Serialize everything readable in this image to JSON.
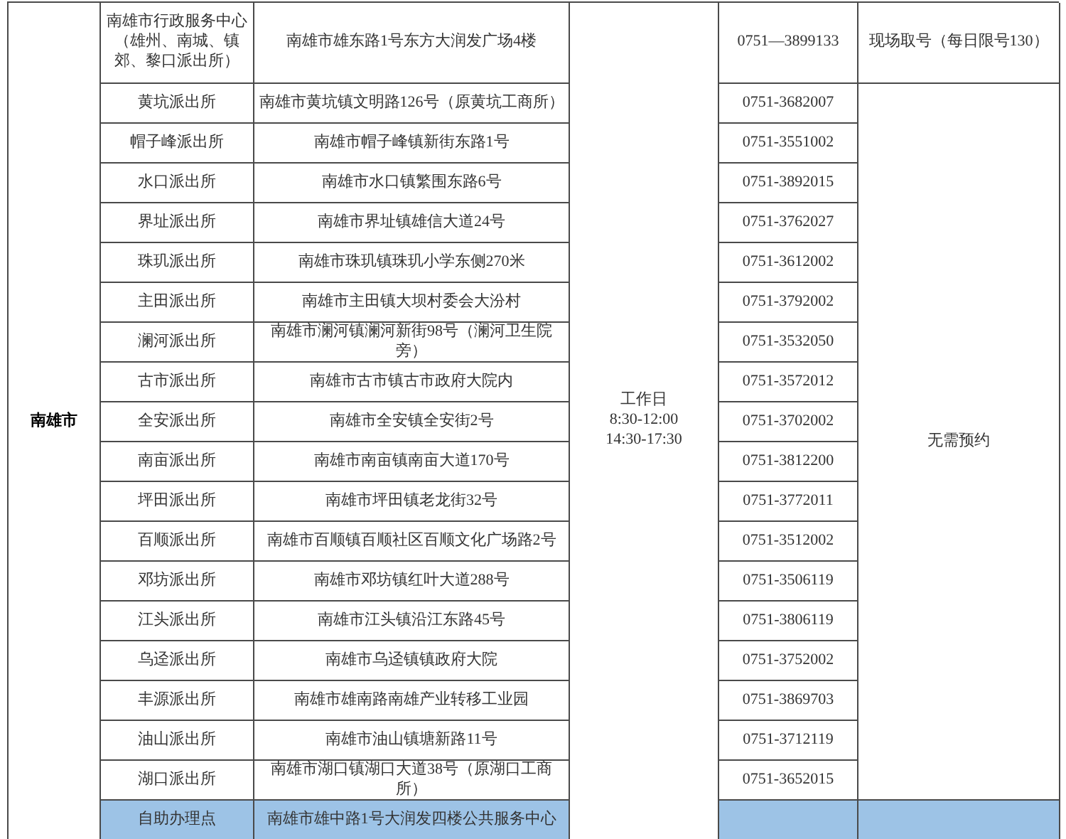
{
  "city": "南雄市",
  "hours": [
    "工作日",
    "8:30-12:00",
    "14:30-17:30"
  ],
  "shared_appointment": "无需预约",
  "rows": [
    {
      "kind": "station",
      "name": "南雄市行政服务中心（雄州、南城、镇郊、黎口派出所）",
      "address": "南雄市雄东路1号东方大润发广场4楼",
      "phone": "0751—3899133",
      "appointment": "现场取号（每日限号130）"
    },
    {
      "kind": "station",
      "name": "黄坑派出所",
      "address": "南雄市黄坑镇文明路126号（原黄坑工商所）",
      "phone": "0751-3682007"
    },
    {
      "kind": "station",
      "name": "帽子峰派出所",
      "address": "南雄市帽子峰镇新街东路1号",
      "phone": "0751-3551002"
    },
    {
      "kind": "station",
      "name": "水口派出所",
      "address": "南雄市水口镇繁围东路6号",
      "phone": "0751-3892015"
    },
    {
      "kind": "station",
      "name": "界址派出所",
      "address": "南雄市界址镇雄信大道24号",
      "phone": "0751-3762027"
    },
    {
      "kind": "station",
      "name": "珠玑派出所",
      "address": "南雄市珠玑镇珠玑小学东侧270米",
      "phone": "0751-3612002"
    },
    {
      "kind": "station",
      "name": "主田派出所",
      "address": "南雄市主田镇大坝村委会大汾村",
      "phone": "0751-3792002"
    },
    {
      "kind": "station",
      "name": "澜河派出所",
      "address": "南雄市澜河镇澜河新街98号（澜河卫生院旁）",
      "phone": "0751-3532050"
    },
    {
      "kind": "station",
      "name": "古市派出所",
      "address": "南雄市古市镇古市政府大院内",
      "phone": "0751-3572012"
    },
    {
      "kind": "station",
      "name": "全安派出所",
      "address": "南雄市全安镇全安街2号",
      "phone": "0751-3702002"
    },
    {
      "kind": "station",
      "name": "南亩派出所",
      "address": "南雄市南亩镇南亩大道170号",
      "phone": "0751-3812200"
    },
    {
      "kind": "station",
      "name": "坪田派出所",
      "address": "南雄市坪田镇老龙街32号",
      "phone": "0751-3772011"
    },
    {
      "kind": "station",
      "name": "百顺派出所",
      "address": "南雄市百顺镇百顺社区百顺文化广场路2号",
      "phone": "0751-3512002"
    },
    {
      "kind": "station",
      "name": "邓坊派出所",
      "address": "南雄市邓坊镇红叶大道288号",
      "phone": "0751-3506119"
    },
    {
      "kind": "station",
      "name": "江头派出所",
      "address": "南雄市江头镇沿江东路45号",
      "phone": "0751-3806119"
    },
    {
      "kind": "station",
      "name": "乌迳派出所",
      "address": "南雄市乌迳镇镇政府大院",
      "phone": "0751-3752002"
    },
    {
      "kind": "station",
      "name": "丰源派出所",
      "address": "南雄市雄南路南雄产业转移工业园",
      "phone": "0751-3869703"
    },
    {
      "kind": "station",
      "name": "油山派出所",
      "address": "南雄市油山镇塘新路11号",
      "phone": "0751-3712119"
    },
    {
      "kind": "station",
      "name": "湖口派出所",
      "address": "南雄市湖口镇湖口大道38号（原湖口工商所）",
      "phone": "0751-3652015"
    },
    {
      "kind": "self_service",
      "name": "自助办理点",
      "address": "南雄市雄中路1号大润发四楼公共服务中心"
    }
  ]
}
